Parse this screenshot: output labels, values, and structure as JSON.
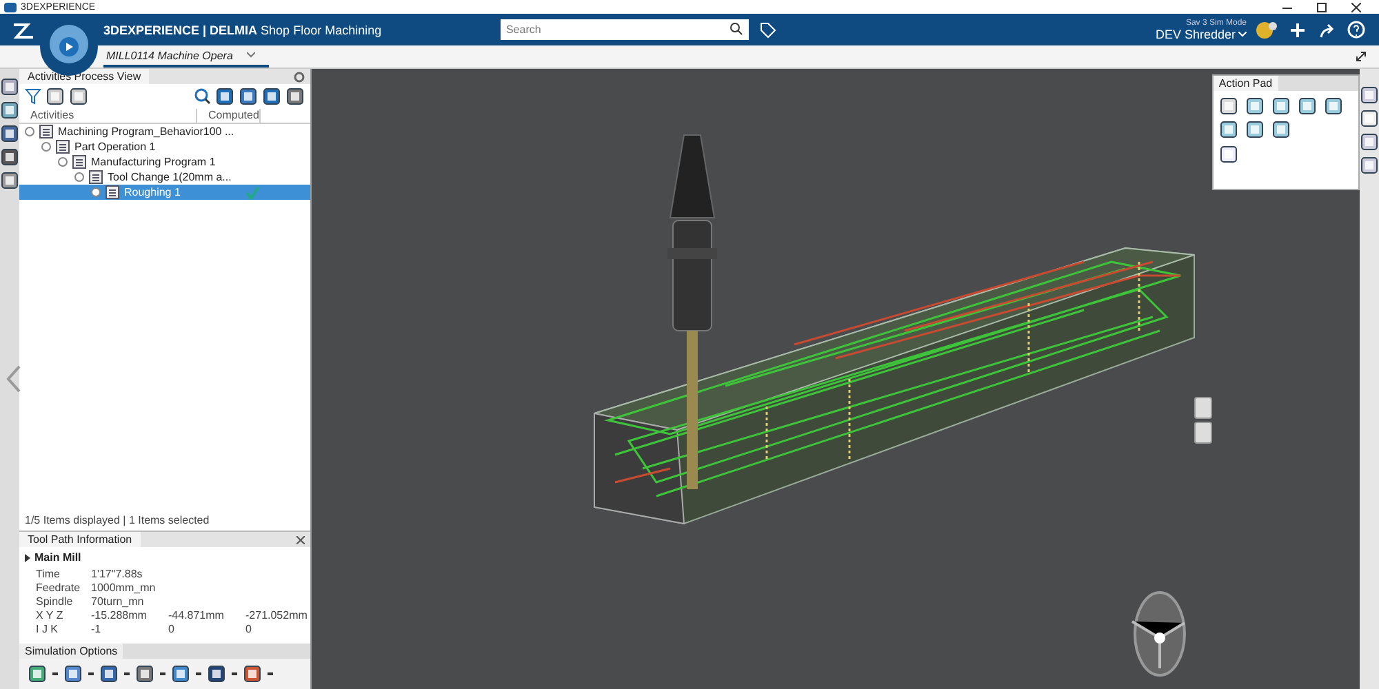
{
  "app_title": "3DEXPERIENCE",
  "header": {
    "brand": "3DEXPERIENCE | DELMIA",
    "app": "Shop Floor Machining",
    "search": {
      "placeholder": "Search"
    },
    "user_role": "Sav 3 Sim Mode",
    "user": "DEV Shredder"
  },
  "tab": {
    "label": "MILL0114 Machine Opera",
    "selected": true
  },
  "process_view": {
    "title": "Activities Process View",
    "columns": [
      "Activities",
      "Computed"
    ],
    "tree": [
      {
        "label": "Machining Program_Behavior100 ...",
        "selected": false,
        "computed": false,
        "children": [
          {
            "label": "Part Operation 1",
            "selected": false,
            "computed": false,
            "children": [
              {
                "label": "Manufacturing Program 1",
                "selected": false,
                "computed": false,
                "children": [
                  {
                    "label": "Tool Change 1(20mm a...",
                    "selected": false,
                    "computed": false,
                    "children": [
                      {
                        "label": "Roughing 1",
                        "selected": true,
                        "computed": true
                      }
                    ]
                  }
                ]
              }
            ]
          }
        ]
      }
    ],
    "status": "1/5 Items displayed | 1 Items selected"
  },
  "tool_path_info": {
    "title": "Tool Path Information",
    "section": "Main Mill",
    "rows": [
      {
        "label": "Time",
        "values": [
          "1'17\"7.88s"
        ]
      },
      {
        "label": "Feedrate",
        "values": [
          "1000mm_mn"
        ]
      },
      {
        "label": "Spindle",
        "values": [
          "70turn_mn"
        ]
      },
      {
        "label": "X Y Z",
        "values": [
          "-15.288mm",
          "-44.871mm",
          "-271.052mm"
        ]
      },
      {
        "label": "I J K",
        "values": [
          "-1",
          "0",
          "0"
        ]
      }
    ]
  },
  "simulation_options": {
    "title": "Simulation Options"
  },
  "action_pad": {
    "title": "Action Pad"
  }
}
